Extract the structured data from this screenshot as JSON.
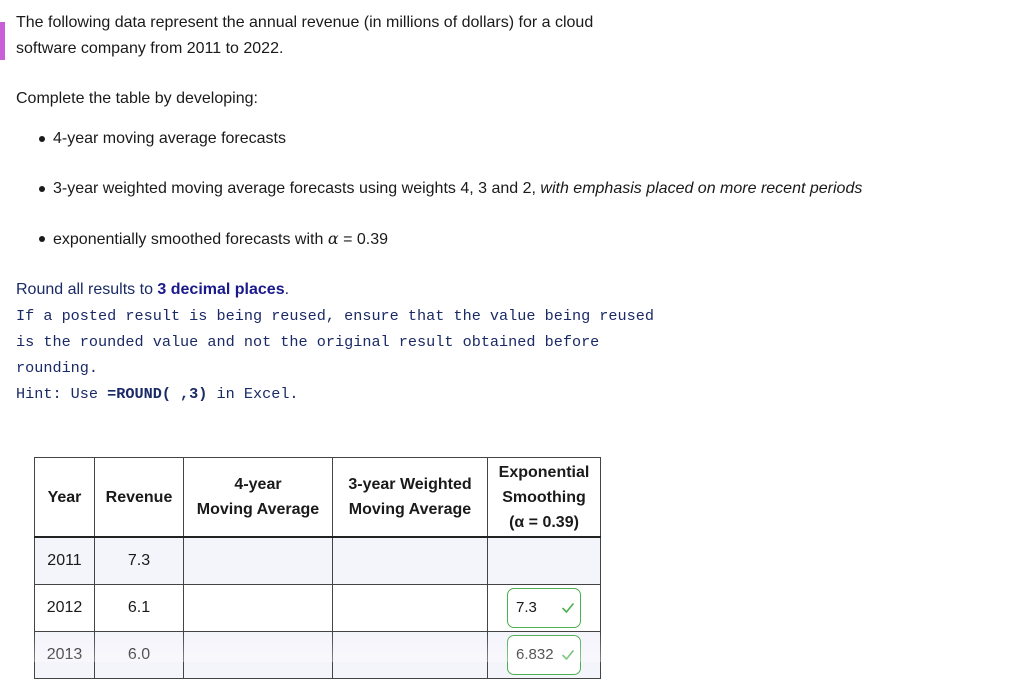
{
  "problem": {
    "intro": "The following data represent the annual revenue (in millions of dollars) for a cloud software company from 2011 to 2022.",
    "instruction": "Complete the table by developing:",
    "tasks": {
      "item1": "4-year moving average forecasts",
      "item2_main": "3-year weighted moving average forecasts using weights 4, 3 and 2, ",
      "item2_italic": "with emphasis placed on more recent periods",
      "item3_main": "exponentially smoothed forecasts with ",
      "item3_alpha": "α",
      "item3_value": " = 0.39"
    },
    "round_note": {
      "prefix": "Round all results to ",
      "bold": "3 decimal places",
      "suffix": "."
    },
    "reuse_note": "If a posted result is being reused, ensure that the value being reused is the rounded value and not the original result obtained before rounding.",
    "hint": {
      "prefix": "Hint: Use ",
      "func": "=ROUND( ,3)",
      "suffix": " in Excel."
    }
  },
  "table": {
    "headers": {
      "year": "Year",
      "revenue": "Revenue",
      "ma_line1": "4-year",
      "ma_line2": "Moving Average",
      "wma_line1": "3-year Weighted",
      "wma_line2": "Moving Average",
      "es_line1": "Exponential",
      "es_line2": "Smoothing",
      "es_line3": "(α = 0.39)"
    },
    "rows": [
      {
        "year": "2011",
        "revenue": "7.3",
        "es": ""
      },
      {
        "year": "2012",
        "revenue": "6.1",
        "es": "7.3"
      },
      {
        "year": "2013",
        "revenue": "6.0",
        "es": "6.832"
      }
    ]
  },
  "colors": {
    "accent": "#c95fd6",
    "correct": "#4caf50",
    "note_text": "#1a2a66"
  }
}
